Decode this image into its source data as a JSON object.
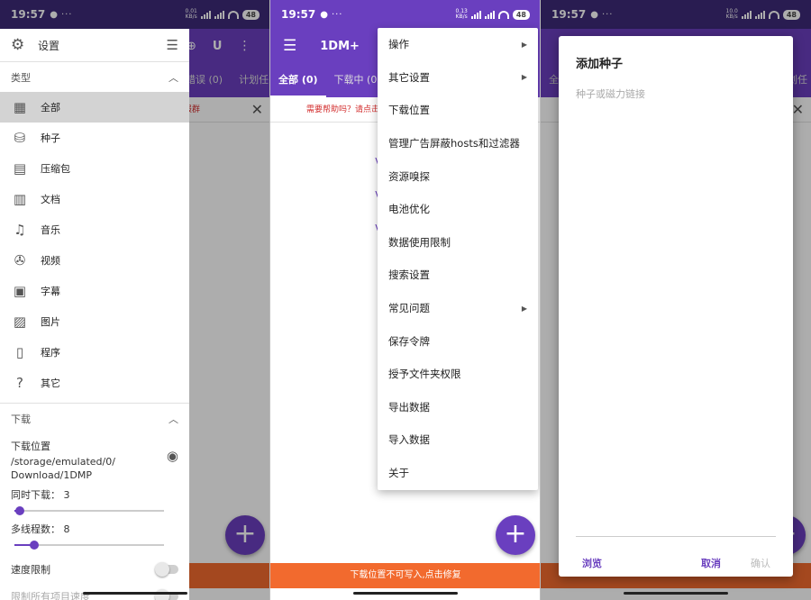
{
  "status": {
    "time": "19:57",
    "battery": "48",
    "net_speeds": [
      "0.01",
      "0.13",
      "10.0"
    ],
    "net_unit": "KB/s"
  },
  "colors": {
    "primary": "#6a3fbf",
    "warning_bar": "#f26a2e",
    "notice_text": "#d32f2f"
  },
  "app": {
    "title": "1DM+"
  },
  "tabs": [
    "全部 (0)",
    "下载中 (0)",
    "错误 (0)",
    "计划任"
  ],
  "notice": {
    "panel1": "加入我们的电报群",
    "panel2": "需要帮助吗？请点击这里加入我们的电报群"
  },
  "bottom_bar": "下载位置不可写入,点击修复",
  "drawer": {
    "title": "设置",
    "types_header": "类型",
    "categories": [
      {
        "label": "全部",
        "icon": "grid-icon"
      },
      {
        "label": "种子",
        "icon": "torrent-icon"
      },
      {
        "label": "压缩包",
        "icon": "archive-icon"
      },
      {
        "label": "文档",
        "icon": "document-icon"
      },
      {
        "label": "音乐",
        "icon": "music-icon"
      },
      {
        "label": "视频",
        "icon": "video-reel-icon"
      },
      {
        "label": "字幕",
        "icon": "subtitle-icon"
      },
      {
        "label": "图片",
        "icon": "image-icon"
      },
      {
        "label": "程序",
        "icon": "phone-icon"
      },
      {
        "label": "其它",
        "icon": "unknown-file-icon"
      }
    ],
    "download_header": "下载",
    "download_location_label": "下载位置",
    "download_location_path": "/storage/emulated/0/\nDownload/1DMP",
    "concurrent_label": "同时下载： 3",
    "concurrent_value": 3,
    "threads_label": "多线程数：  8",
    "threads_value": 8,
    "speed_limit_label": "速度限制",
    "limit_all_label": "限制所有项目速度"
  },
  "menu": {
    "items": [
      {
        "label": "操作",
        "submenu": true
      },
      {
        "label": "其它设置",
        "submenu": true
      },
      {
        "label": "下载位置",
        "submenu": false
      },
      {
        "label": "管理广告屏蔽hosts和过滤器",
        "submenu": false
      },
      {
        "label": "资源嗅探",
        "submenu": false
      },
      {
        "label": "电池优化",
        "submenu": false
      },
      {
        "label": "数据使用限制",
        "submenu": false
      },
      {
        "label": "搜索设置",
        "submenu": false
      },
      {
        "label": "常见问题",
        "submenu": true
      },
      {
        "label": "保存令牌",
        "submenu": false
      },
      {
        "label": "授予文件夹权限",
        "submenu": false
      },
      {
        "label": "导出数据",
        "submenu": false
      },
      {
        "label": "导入数据",
        "submenu": false
      },
      {
        "label": "关于",
        "submenu": false
      }
    ]
  },
  "dialog": {
    "title": "添加种子",
    "placeholder": "种子或磁力链接",
    "value": "",
    "browse": "浏览",
    "cancel": "取消",
    "confirm": "确认"
  }
}
